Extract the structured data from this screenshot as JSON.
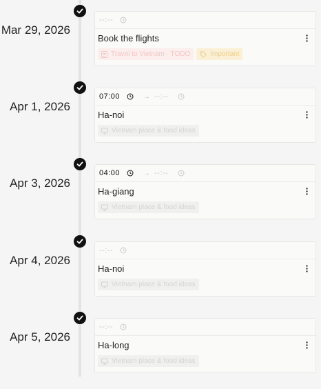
{
  "empty_time": "--:--",
  "arrow": "→",
  "entries": [
    {
      "date": "Mar 29, 2026",
      "start_time": "--:--",
      "title": "Book the flights",
      "tags": [
        {
          "label": "Travel to Vietnam · TODO",
          "icon": "doc-icon",
          "color": "#f2c7c4"
        },
        {
          "label": "Important",
          "icon": "tag-icon",
          "color": "#e8cf93"
        }
      ]
    },
    {
      "date": "Apr 1, 2026",
      "start_time": "07:00",
      "end_time": "--:--",
      "title": "Ha-noi",
      "tags": [
        {
          "label": "Vietnam place & food ideas",
          "icon": "monitor-icon"
        }
      ]
    },
    {
      "date": "Apr 3, 2026",
      "start_time": "04:00",
      "end_time": "--:--",
      "title": "Ha-giang",
      "tags": [
        {
          "label": "Vietnam place & food ideas",
          "icon": "monitor-icon"
        }
      ]
    },
    {
      "date": "Apr 4, 2026",
      "start_time": "--:--",
      "title": "Ha-noi",
      "tags": [
        {
          "label": "Vietnam place & food ideas",
          "icon": "monitor-icon"
        }
      ]
    },
    {
      "date": "Apr 5, 2026",
      "start_time": "--:--",
      "title": "Ha-long",
      "tags": [
        {
          "label": "Vietnam place & food ideas",
          "icon": "monitor-icon"
        }
      ]
    }
  ]
}
